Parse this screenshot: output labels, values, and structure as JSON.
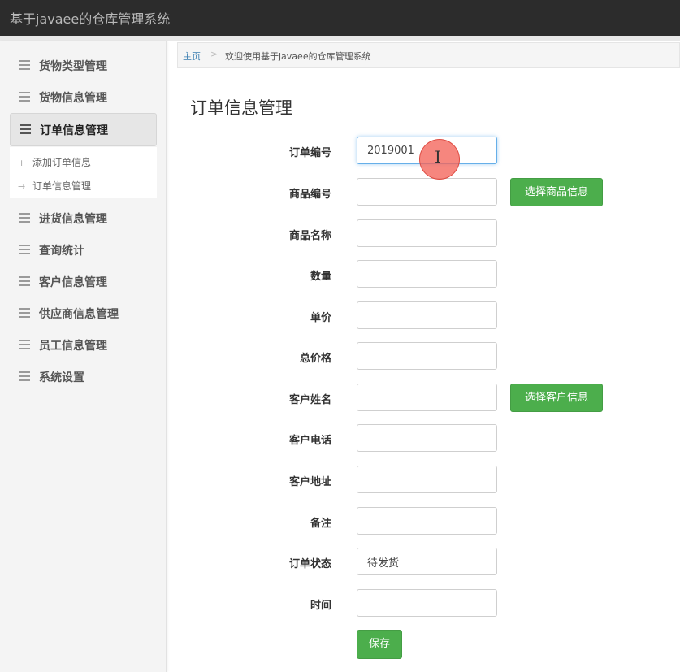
{
  "app": {
    "title": "基于javaee的仓库管理系统"
  },
  "sidebar": {
    "items": [
      {
        "label": "货物类型管理"
      },
      {
        "label": "货物信息管理"
      },
      {
        "label": "订单信息管理",
        "active": true
      },
      {
        "label": "进货信息管理"
      },
      {
        "label": "查询统计"
      },
      {
        "label": "客户信息管理"
      },
      {
        "label": "供应商信息管理"
      },
      {
        "label": "员工信息管理"
      },
      {
        "label": "系统设置"
      }
    ],
    "submenu": [
      {
        "label": "添加订单信息",
        "icon": "plus-icon"
      },
      {
        "label": "订单信息管理",
        "icon": "arrow-icon"
      }
    ]
  },
  "breadcrumb": {
    "home": "主页",
    "current": "欢迎使用基于javaee的仓库管理系统"
  },
  "page": {
    "title": "订单信息管理"
  },
  "form": {
    "fields": [
      {
        "label": "订单编号",
        "value": "2019001"
      },
      {
        "label": "商品编号",
        "value": "",
        "button": "选择商品信息"
      },
      {
        "label": "商品名称",
        "value": ""
      },
      {
        "label": "数量",
        "value": ""
      },
      {
        "label": "单价",
        "value": ""
      },
      {
        "label": "总价格",
        "value": ""
      },
      {
        "label": "客户姓名",
        "value": "",
        "button": "选择客户信息"
      },
      {
        "label": "客户电话",
        "value": ""
      },
      {
        "label": "客户地址",
        "value": ""
      },
      {
        "label": "备注",
        "value": ""
      },
      {
        "label": "订单状态",
        "value": "待发货"
      },
      {
        "label": "时间",
        "value": ""
      }
    ],
    "save_label": "保存"
  },
  "colors": {
    "topbar": "#2c2c2c",
    "button": "#4cae4c",
    "link": "#3c7fb1"
  }
}
